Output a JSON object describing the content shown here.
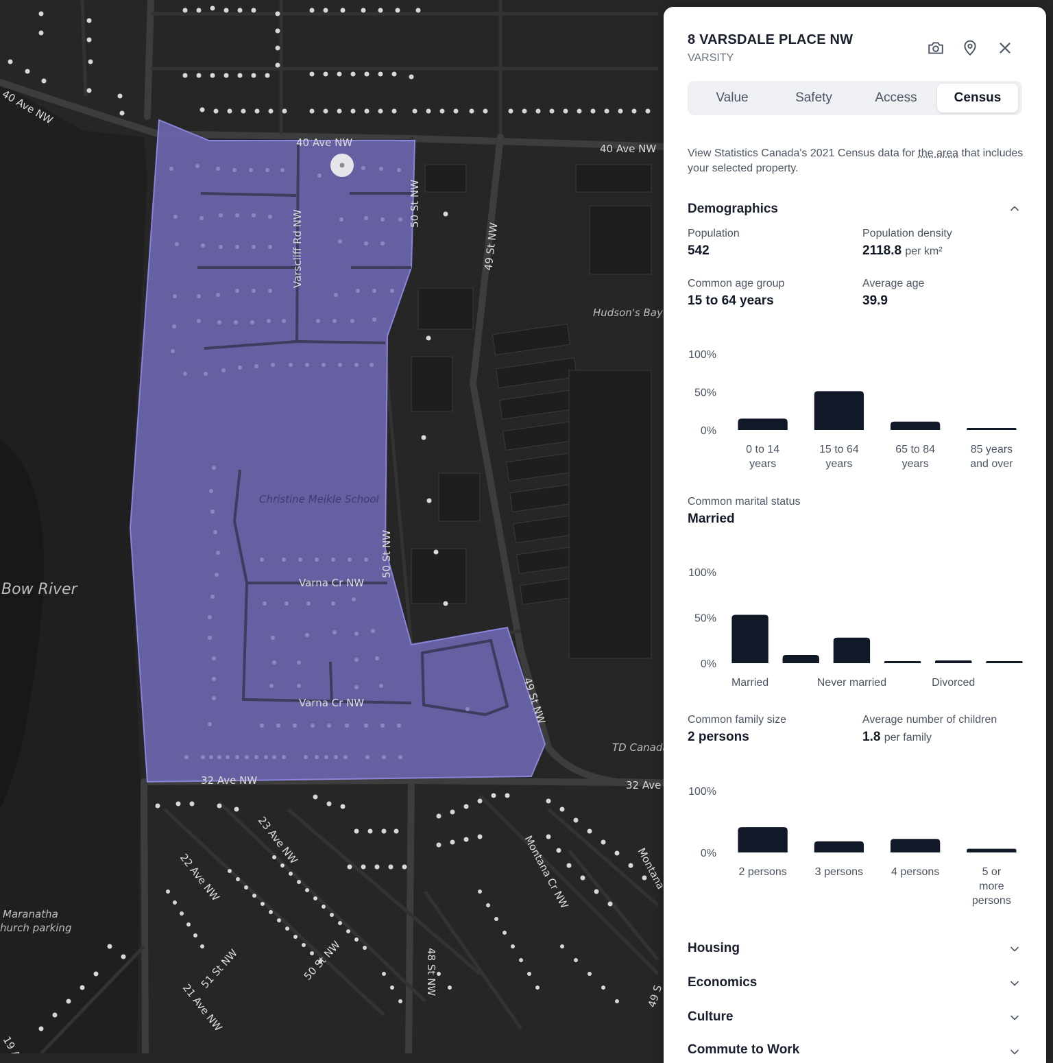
{
  "map": {
    "streets": {
      "s1": "40 Ave NW",
      "s2": "40 Ave NW",
      "s3": "40 Ave NW",
      "s4": "50 St NW",
      "s5": "49 St NW",
      "s6": "Varscliff Rd NW",
      "s7": "50 St NW",
      "s8": "Varna Cr NW",
      "s9": "Varna Cr NW",
      "s10": "49 St NW",
      "s11": "32 Ave NW",
      "s12": "32 Ave",
      "s13": "23 Ave NW",
      "s14": "22 Ave NW",
      "s15": "51 St NW",
      "s16": "50 St NW",
      "s17": "48 St NW",
      "s18": "21 Ave NW",
      "s19": "Montana Cr NW",
      "s20": "Montana",
      "s21": "19 A",
      "s22": "49 S"
    },
    "places": {
      "p1": "Hudson's Bay",
      "p2": "Christine Meikle School",
      "p3": "Bow River",
      "p4": "TD Canada",
      "p5": "Maranatha",
      "p6": "hurch parking"
    },
    "colors": {
      "background": "#262626",
      "road": "#3f3f3f",
      "area_fill": "#6a65ad",
      "area_border": "#8a84d8"
    }
  },
  "panel": {
    "title": "8 VARSDALE PLACE NW",
    "subtitle": "VARSITY",
    "icons": {
      "camera": "camera-icon",
      "pin": "map-pin-icon",
      "close": "close-icon"
    },
    "tabs": [
      {
        "label": "Value"
      },
      {
        "label": "Safety"
      },
      {
        "label": "Access"
      },
      {
        "label": "Census"
      }
    ],
    "active_tab": "Census",
    "intro_before": "View Statistics Canada's 2021 Census data for ",
    "intro_link": "the area",
    "intro_after": " that includes your selected property.",
    "demographics": {
      "heading": "Demographics",
      "population_label": "Population",
      "population_value": "542",
      "density_label": "Population density",
      "density_value": "2118.8",
      "density_unit": "per km²",
      "age_group_label": "Common age group",
      "age_group_value": "15 to 64 years",
      "avg_age_label": "Average age",
      "avg_age_value": "39.9",
      "marital_label": "Common marital status",
      "marital_value": "Married",
      "family_label": "Common family size",
      "family_value": "2 persons",
      "children_label": "Average number of children",
      "children_value": "1.8",
      "children_unit": "per family"
    },
    "sections": [
      {
        "label": "Housing"
      },
      {
        "label": "Economics"
      },
      {
        "label": "Culture"
      },
      {
        "label": "Commute to Work"
      }
    ],
    "bar_color": "#111827"
  },
  "chart_data": [
    {
      "type": "bar",
      "title": "",
      "categories": [
        [
          "0 to 14",
          "years"
        ],
        [
          "15 to 64",
          "years"
        ],
        [
          "65 to 84",
          "years"
        ],
        [
          "85 years",
          "and over"
        ]
      ],
      "values": [
        15,
        51,
        11,
        2
      ],
      "yticks": [
        "100%",
        "50%",
        "0%"
      ],
      "ylim": [
        0,
        100
      ]
    },
    {
      "type": "bar",
      "title": "",
      "categories": [
        [
          "Married"
        ],
        [
          ""
        ],
        [
          "Never married"
        ],
        [
          ""
        ],
        [
          "Divorced"
        ],
        [
          ""
        ]
      ],
      "values": [
        53,
        9,
        28,
        2,
        3,
        2
      ],
      "yticks": [
        "100%",
        "50%",
        "0%"
      ],
      "ylim": [
        0,
        100
      ]
    },
    {
      "type": "bar",
      "title": "",
      "categories": [
        [
          "2 persons"
        ],
        [
          "3 persons"
        ],
        [
          "4 persons"
        ],
        [
          "5 or",
          "more",
          "persons"
        ]
      ],
      "values": [
        41,
        18,
        22,
        6
      ],
      "yticks": [
        "100%",
        "0%"
      ],
      "ylim": [
        0,
        100
      ]
    }
  ]
}
